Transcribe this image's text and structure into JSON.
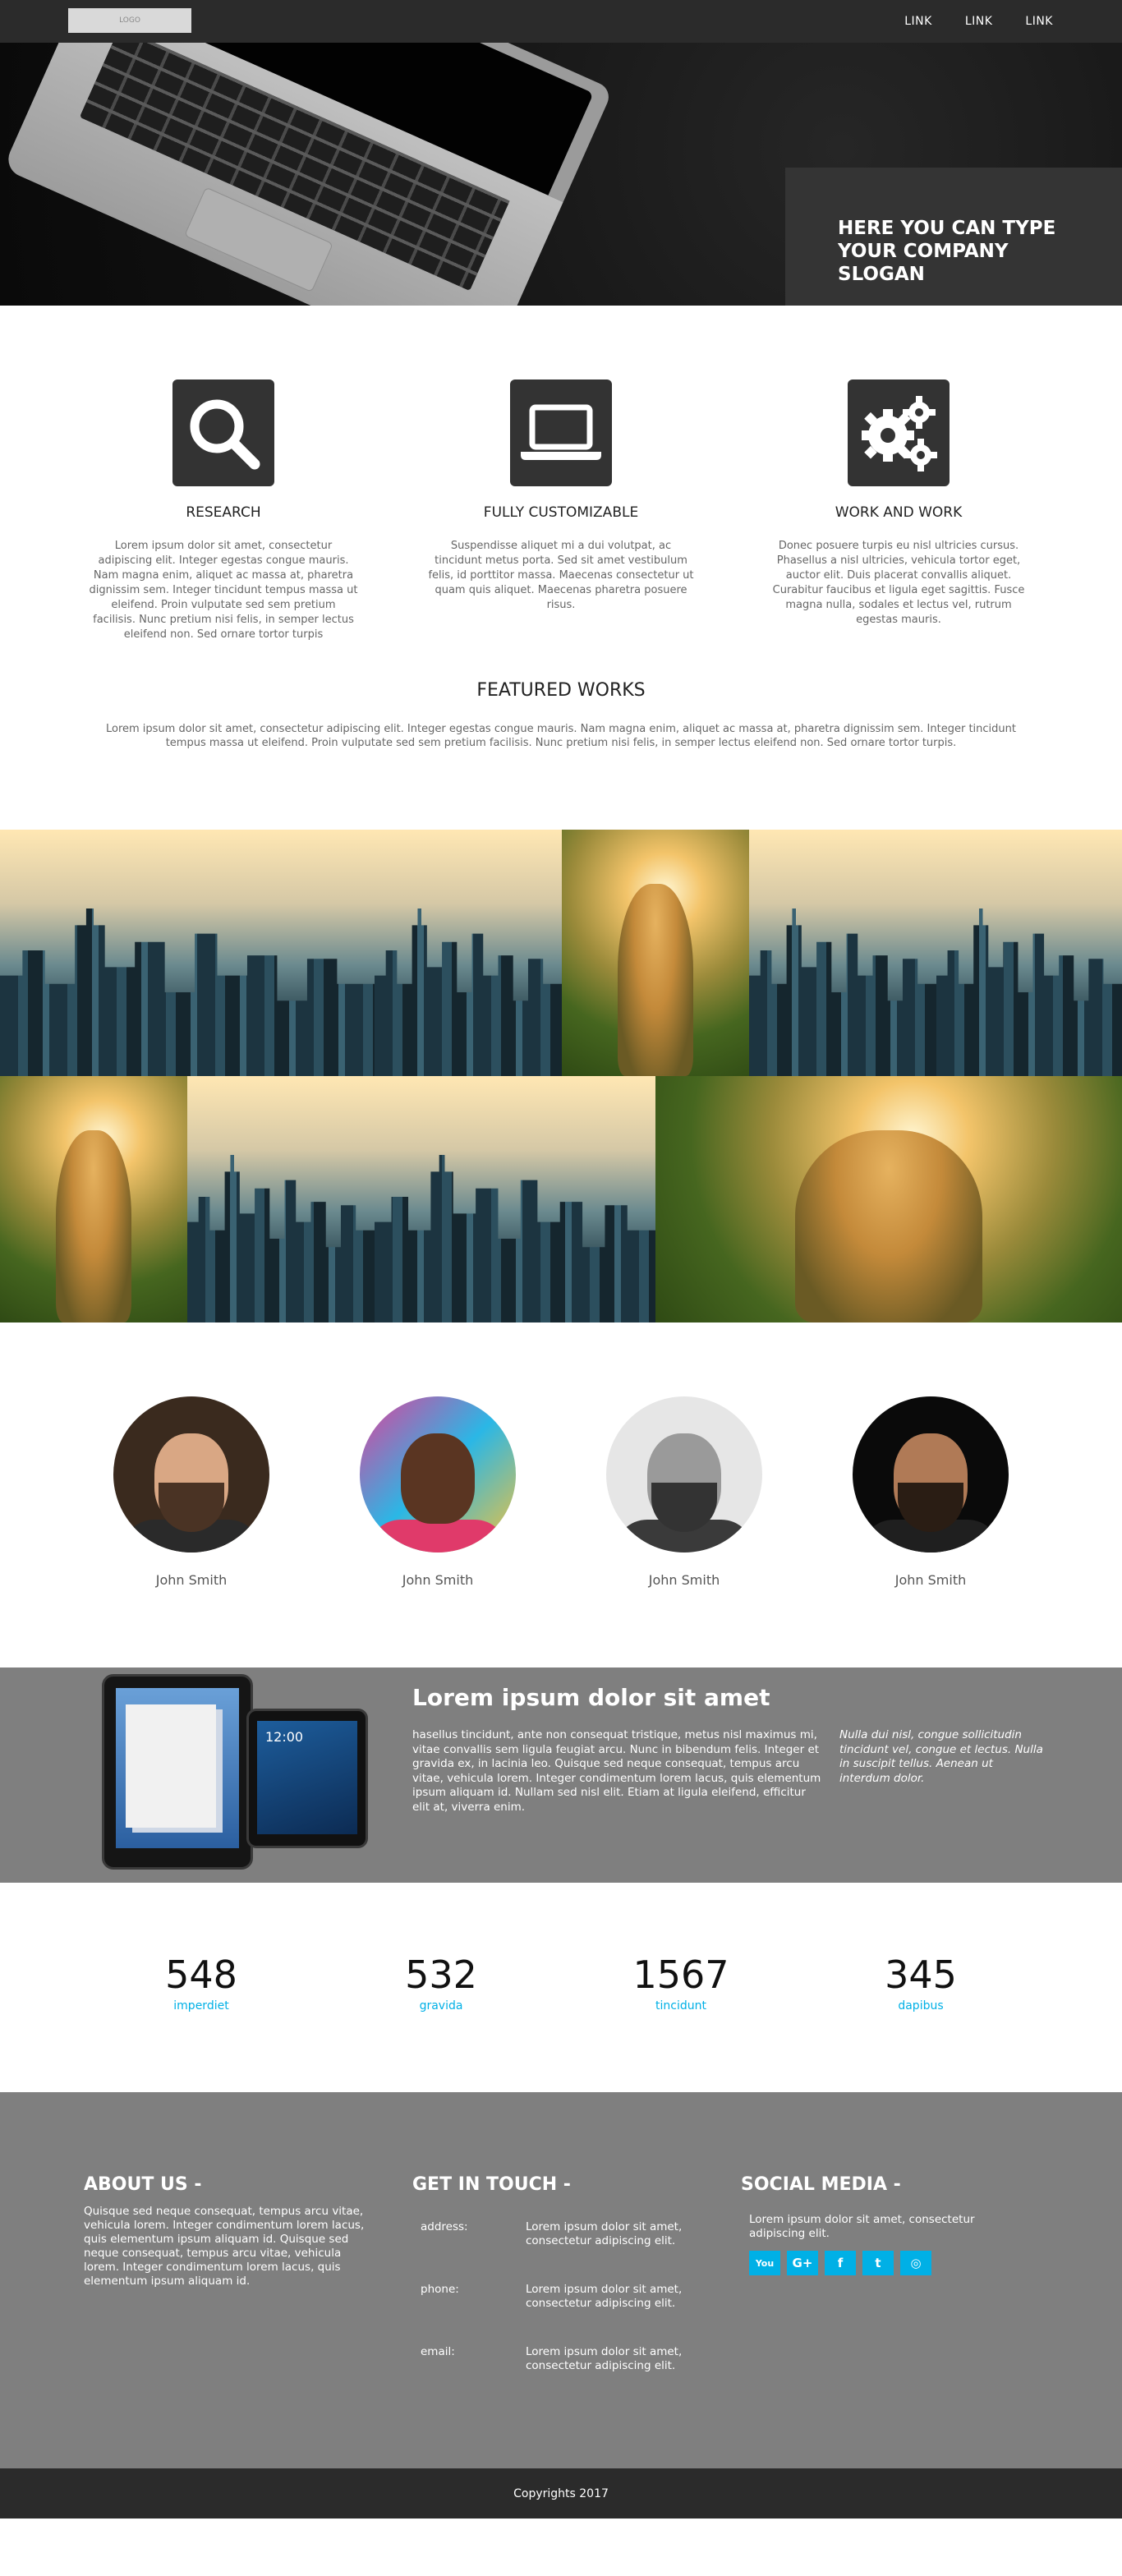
{
  "navbar": {
    "logo_text": "LOGO",
    "links": [
      "LINK",
      "LINK",
      "LINK"
    ]
  },
  "hero": {
    "slogan": "HERE YOU CAN TYPE YOUR COMPANY SLOGAN"
  },
  "features": [
    {
      "icon": "search-icon",
      "title": "RESEARCH",
      "text": "Lorem ipsum dolor sit amet, consectetur adipiscing elit. Integer egestas congue mauris. Nam magna enim, aliquet ac massa at, pharetra dignissim sem. Integer tincidunt tempus massa ut eleifend. Proin vulputate sed sem pretium facilisis. Nunc pretium nisi felis, in semper lectus eleifend non. Sed ornare tortor turpis"
    },
    {
      "icon": "laptop-icon",
      "title": "FULLY CUSTOMIZABLE",
      "text": "Suspendisse aliquet mi a dui volutpat, ac tincidunt metus porta. Sed sit amet vestibulum felis, id porttitor massa. Maecenas consectetur ut quam quis aliquet. Maecenas pharetra posuere risus."
    },
    {
      "icon": "gears-icon",
      "title": "WORK AND WORK",
      "text": "Donec posuere turpis eu nisl ultricies cursus. Phasellus a nisl ultricies, vehicula tortor eget, auctor elit. Duis placerat convallis aliquet. Curabitur faucibus et ligula eget sagittis. Fusce magna nulla, sodales et lectus vel, rutrum egestas mauris."
    }
  ],
  "works": {
    "title": "FEATURED WORKS",
    "text": "Lorem ipsum dolor sit amet, consectetur adipiscing elit. Integer egestas congue mauris. Nam magna enim, aliquet ac massa at, pharetra dignissim sem. Integer tincidunt tempus massa ut eleifend. Proin vulputate sed sem pretium facilisis. Nunc pretium nisi felis, in semper lectus eleifend non. Sed ornare tortor turpis."
  },
  "team": [
    {
      "name": "John Smith"
    },
    {
      "name": "John Smith"
    },
    {
      "name": "John Smith"
    },
    {
      "name": "John Smith"
    }
  ],
  "promo": {
    "title": "Lorem ipsum dolor sit amet",
    "text": "hasellus tincidunt, ante non consequat tristique, metus nisl maximus mi, vitae convallis sem ligula feugiat arcu. Nunc in bibendum felis. Integer et gravida ex, in lacinia leo. Quisque sed neque consequat, tempus arcu vitae, vehicula lorem. Integer condimentum lorem lacus, quis elementum ipsum aliquam id. Nullam sed nisl elit. Etiam at ligula eleifend, efficitur elit at, viverra enim.",
    "quote": "Nulla dui nisl, congue sollicitudin tincidunt vel, congue et lectus. Nulla in suscipit tellus. Aenean ut interdum dolor.",
    "tablet_clock": "12:00"
  },
  "stats": [
    {
      "value": "548",
      "label": "imperdiet"
    },
    {
      "value": "532",
      "label": "gravida"
    },
    {
      "value": "1567",
      "label": "tincidunt"
    },
    {
      "value": "345",
      "label": "dapibus"
    }
  ],
  "footer": {
    "about_title": "ABOUT US -",
    "about_text": "Quisque sed neque consequat, tempus arcu vitae, vehicula lorem. Integer condimentum lorem lacus, quis elementum ipsum aliquam id. Quisque sed neque consequat, tempus arcu vitae, vehicula lorem. Integer condimentum lorem lacus, quis elementum ipsum aliquam id.",
    "contact_title": "GET IN TOUCH -",
    "contact": [
      {
        "key": "address:",
        "value": "Lorem ipsum dolor sit amet, consectetur adipiscing elit."
      },
      {
        "key": "phone:",
        "value": "Lorem ipsum dolor sit amet, consectetur adipiscing elit."
      },
      {
        "key": "email:",
        "value": "Lorem ipsum dolor sit amet, consectetur adipiscing elit."
      }
    ],
    "social_title": "SOCIAL MEDIA -",
    "social_text": "Lorem ipsum dolor sit amet, consectetur adipiscing elit.",
    "social_icons": [
      "youtube-icon",
      "google-plus-icon",
      "facebook-icon",
      "twitter-icon",
      "instagram-icon"
    ],
    "social_glyphs": [
      "You",
      "G+",
      "f",
      "t",
      "◎"
    ],
    "copyright": "Copyrights 2017"
  },
  "colors": {
    "dark": "#2b2b2b",
    "gray_band": "#7f7f7f",
    "accent": "#00b0e6"
  }
}
